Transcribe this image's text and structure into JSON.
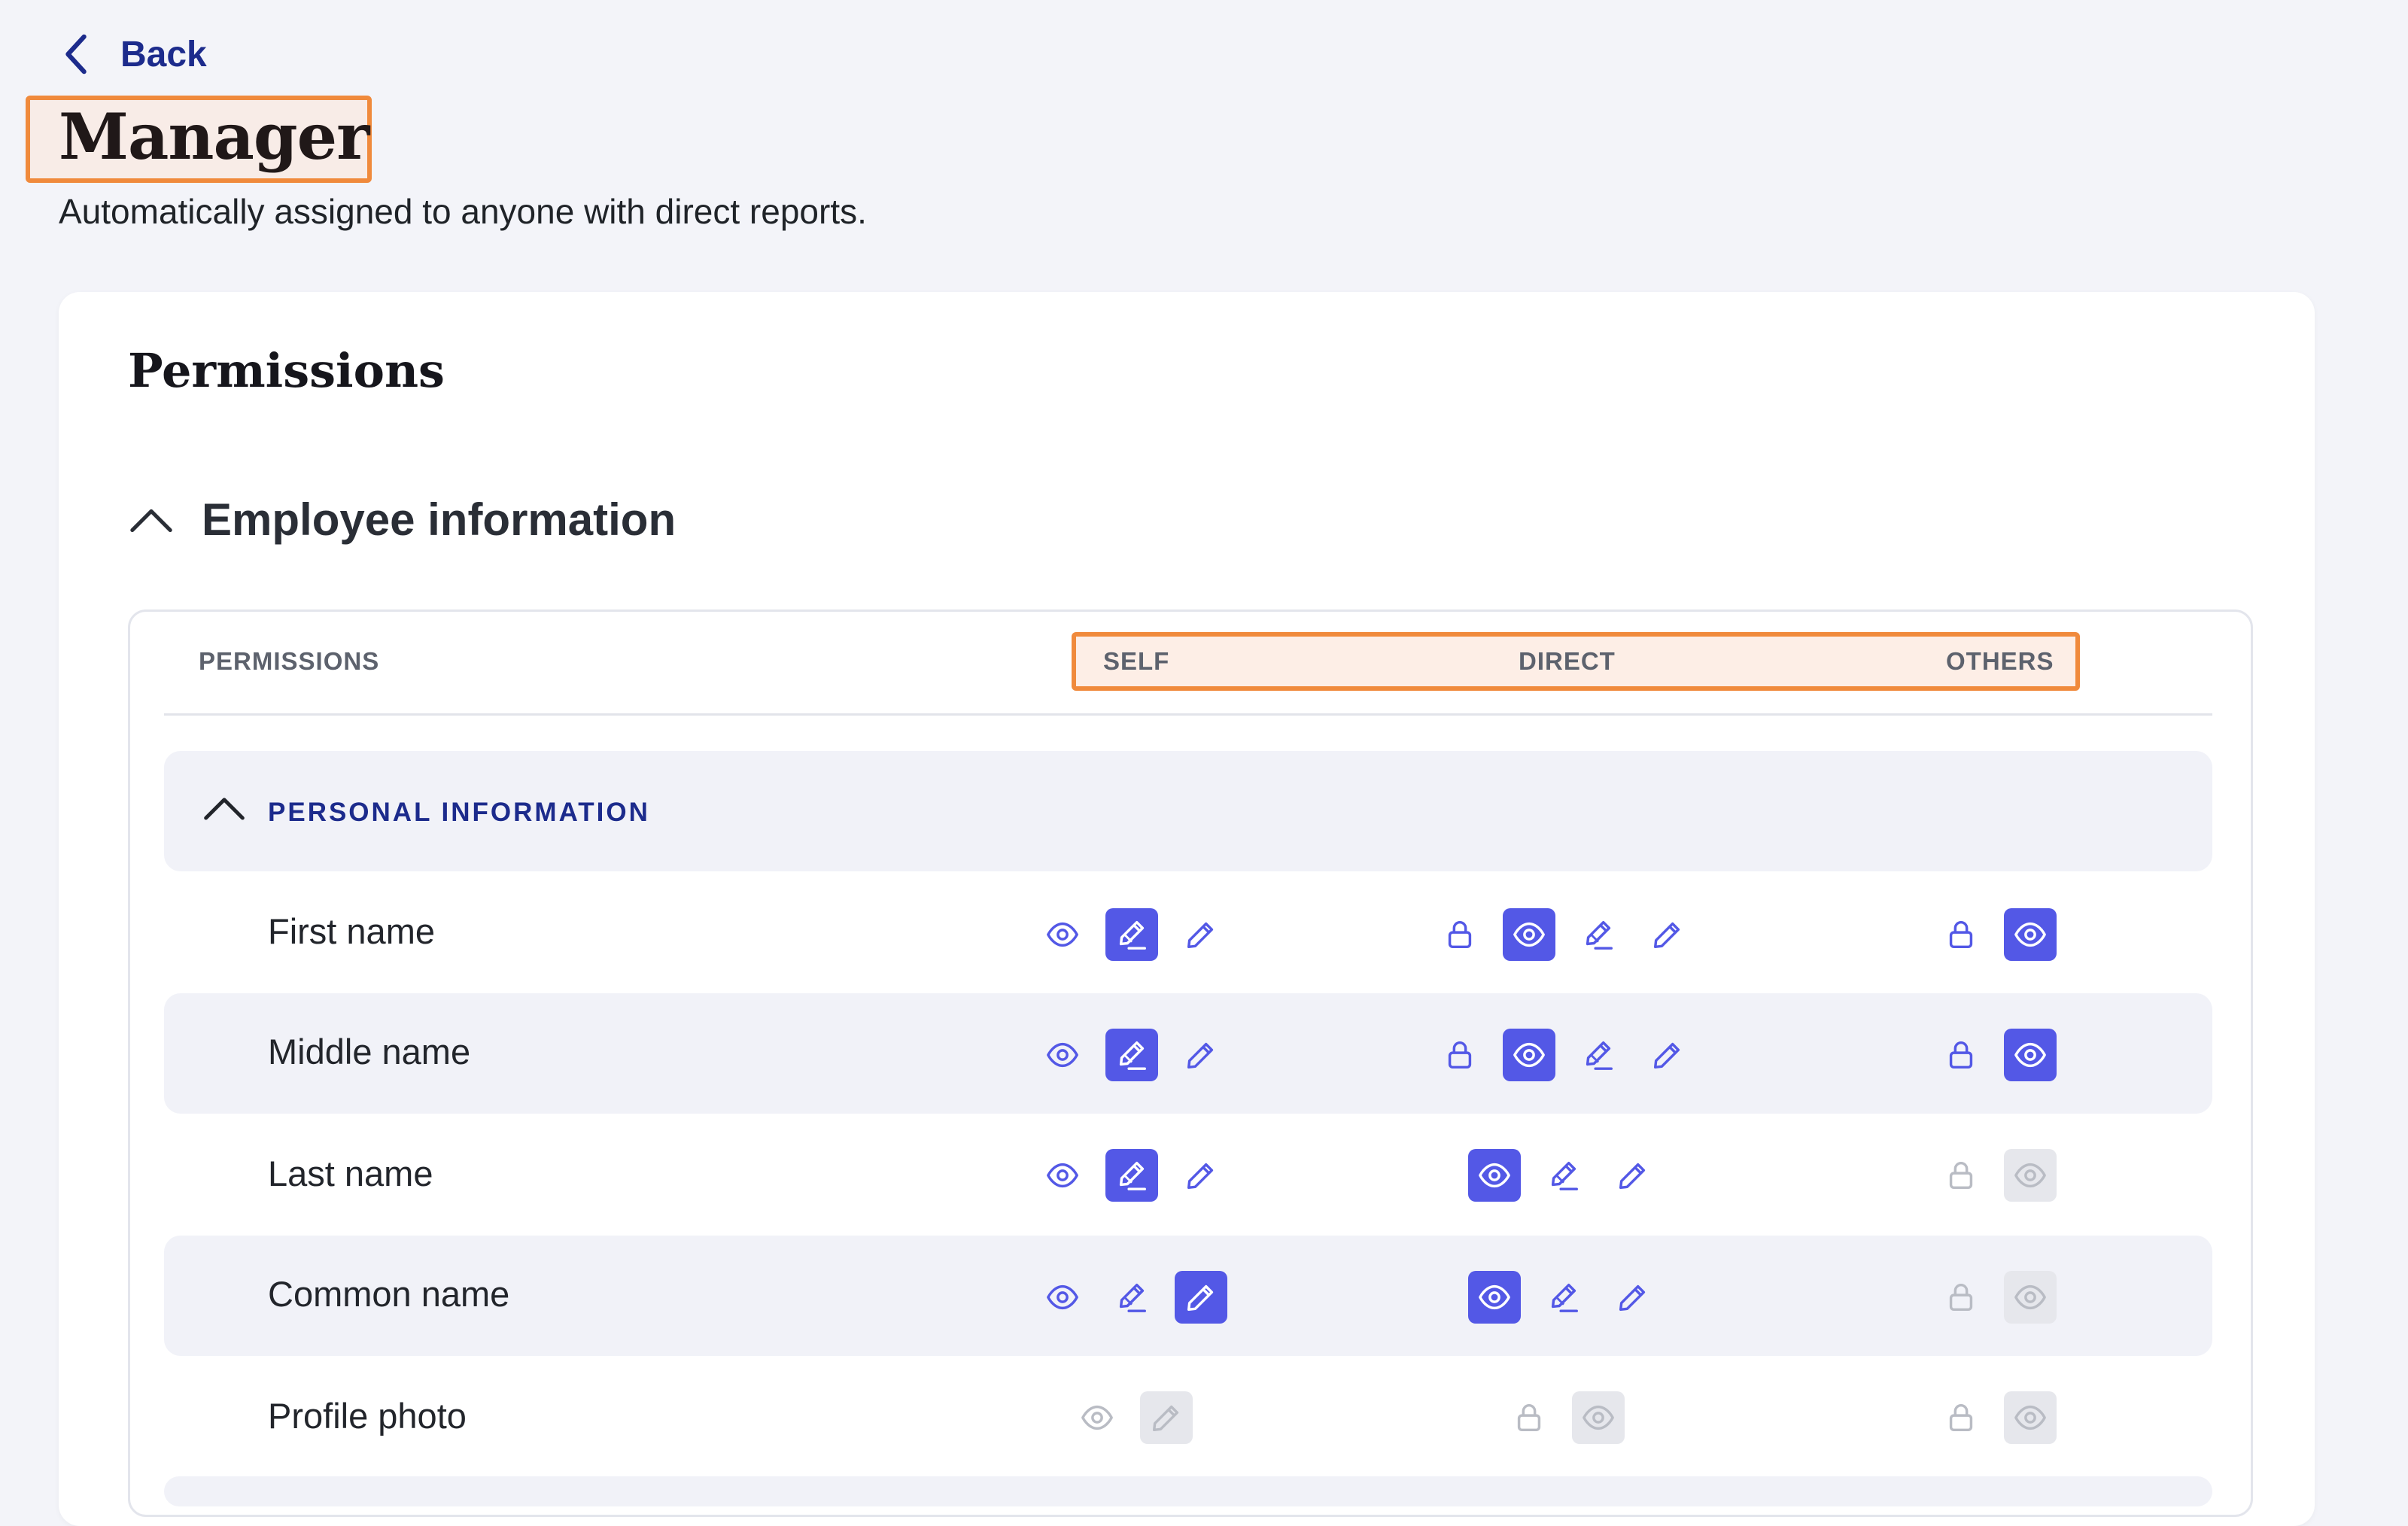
{
  "back": {
    "label": "Back"
  },
  "role": {
    "title": "Manager",
    "subtitle": "Automatically assigned to anyone with direct reports."
  },
  "card": {
    "title": "Permissions"
  },
  "section": {
    "title": "Employee information"
  },
  "table": {
    "headers": {
      "permissions": "PERMISSIONS",
      "self": "SELF",
      "direct": "DIRECT",
      "others": "OTHERS"
    },
    "group": "PERSONAL INFORMATION",
    "rows": [
      {
        "label": "First name",
        "self": [
          {
            "icon": "eye-icon",
            "state": "normal"
          },
          {
            "icon": "edit-request-icon",
            "state": "active"
          },
          {
            "icon": "pencil-icon",
            "state": "normal"
          }
        ],
        "direct": [
          {
            "icon": "lock-icon",
            "state": "normal"
          },
          {
            "icon": "eye-icon",
            "state": "active"
          },
          {
            "icon": "edit-request-icon",
            "state": "normal"
          },
          {
            "icon": "pencil-icon",
            "state": "normal"
          }
        ],
        "others": [
          {
            "icon": "lock-icon",
            "state": "normal"
          },
          {
            "icon": "eye-icon",
            "state": "active"
          }
        ]
      },
      {
        "label": "Middle name",
        "self": [
          {
            "icon": "eye-icon",
            "state": "normal"
          },
          {
            "icon": "edit-request-icon",
            "state": "active"
          },
          {
            "icon": "pencil-icon",
            "state": "normal"
          }
        ],
        "direct": [
          {
            "icon": "lock-icon",
            "state": "normal"
          },
          {
            "icon": "eye-icon",
            "state": "active"
          },
          {
            "icon": "edit-request-icon",
            "state": "normal"
          },
          {
            "icon": "pencil-icon",
            "state": "normal"
          }
        ],
        "others": [
          {
            "icon": "lock-icon",
            "state": "normal"
          },
          {
            "icon": "eye-icon",
            "state": "active"
          }
        ]
      },
      {
        "label": "Last name",
        "self": [
          {
            "icon": "eye-icon",
            "state": "normal"
          },
          {
            "icon": "edit-request-icon",
            "state": "active"
          },
          {
            "icon": "pencil-icon",
            "state": "normal"
          }
        ],
        "direct": [
          {
            "icon": "eye-icon",
            "state": "active"
          },
          {
            "icon": "edit-request-icon",
            "state": "normal"
          },
          {
            "icon": "pencil-icon",
            "state": "normal"
          }
        ],
        "others": [
          {
            "icon": "lock-icon",
            "state": "disabled"
          },
          {
            "icon": "eye-icon",
            "state": "disabled-box"
          }
        ]
      },
      {
        "label": "Common name",
        "self": [
          {
            "icon": "eye-icon",
            "state": "normal"
          },
          {
            "icon": "edit-request-icon",
            "state": "normal"
          },
          {
            "icon": "pencil-icon",
            "state": "active"
          }
        ],
        "direct": [
          {
            "icon": "eye-icon",
            "state": "active"
          },
          {
            "icon": "edit-request-icon",
            "state": "normal"
          },
          {
            "icon": "pencil-icon",
            "state": "normal"
          }
        ],
        "others": [
          {
            "icon": "lock-icon",
            "state": "disabled"
          },
          {
            "icon": "eye-icon",
            "state": "disabled-box"
          }
        ]
      },
      {
        "label": "Profile photo",
        "self": [
          {
            "icon": "eye-icon",
            "state": "disabled"
          },
          {
            "icon": "pencil-icon",
            "state": "disabled-box"
          }
        ],
        "direct": [
          {
            "icon": "lock-icon",
            "state": "disabled"
          },
          {
            "icon": "eye-icon",
            "state": "disabled-box"
          }
        ],
        "others": [
          {
            "icon": "lock-icon",
            "state": "disabled"
          },
          {
            "icon": "eye-icon",
            "state": "disabled-box"
          }
        ]
      }
    ]
  },
  "colors": {
    "accent": "#5358e6",
    "navy": "#1c2b8c",
    "highlight": "#f08a3c",
    "disabled": "#b9bcc4"
  }
}
